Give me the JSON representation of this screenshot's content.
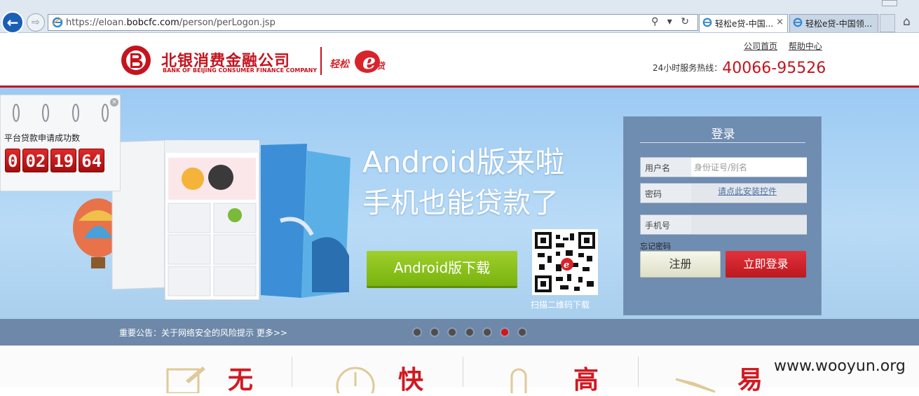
{
  "browser": {
    "url_prefix": "https://eloan.",
    "url_domain": "bobcfc.com",
    "url_path": "/person/perLogon.jsp",
    "tools": "⚲ ▾ ↻",
    "tabs": [
      {
        "label": "轻松e贷-中国...",
        "close": "×"
      },
      {
        "label": "轻松e贷-中国领..."
      }
    ]
  },
  "header": {
    "brand_cn": "北银消费金融公司",
    "brand_en": "BANK OF BEIJING CONSUMER FINANCE COMPANY",
    "links": [
      "公司首页",
      "帮助中心"
    ],
    "hotline_label": "24小时服务热线：",
    "hotline_number": "40066-95526"
  },
  "counter": {
    "title": "平台贷款申请成功数",
    "digits": [
      "0",
      "02",
      "19",
      "64"
    ],
    "close": "×"
  },
  "banner": {
    "headline1": "Android版来啦",
    "headline2": "手机也能贷款了",
    "download_label": "Android版下载",
    "qr_caption": "扫描二维码下载"
  },
  "login": {
    "title": "登录",
    "username_label": "用户名",
    "username_placeholder": "身份证号/别名",
    "password_label": "密码",
    "plugin_link": "请点此安装控件",
    "phone_label": "手机号",
    "forgot": "忘记密码",
    "register": "注册",
    "login_now": "立即登录"
  },
  "notice": {
    "text": "重要公告：关于网络安全的风险提示 更多>>",
    "slides": 7,
    "active_slide": 6
  },
  "features": [
    "无",
    "快",
    "高",
    "易"
  ],
  "watermark": "www.wooyun.org",
  "colors": {
    "brand_red": "#c5141e",
    "banner_blue": "#9ccaf3",
    "login_panel": "#6f8cb1",
    "download_green": "#8cc21d"
  }
}
